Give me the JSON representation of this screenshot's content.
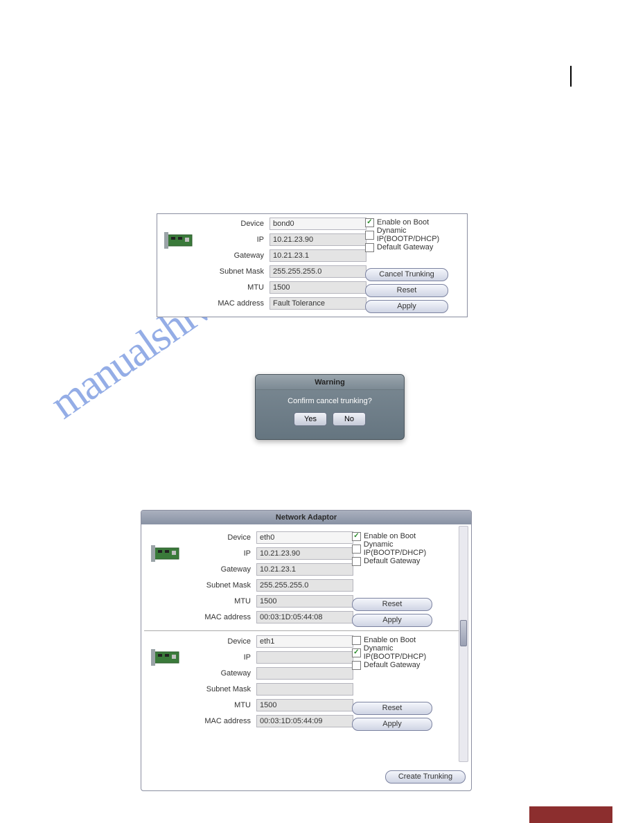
{
  "panel1": {
    "labels": {
      "device": "Device",
      "ip": "IP",
      "gateway": "Gateway",
      "subnet": "Subnet Mask",
      "mtu": "MTU",
      "mac": "MAC address"
    },
    "values": {
      "device": "bond0",
      "ip": "10.21.23.90",
      "gateway": "10.21.23.1",
      "subnet": "255.255.255.0",
      "mtu": "1500",
      "mac": "Fault Tolerance"
    },
    "options": {
      "enable_on_boot": {
        "label": "Enable on Boot",
        "checked": true
      },
      "dynamic_ip": {
        "label": "Dynamic IP(BOOTP/DHCP)",
        "checked": false
      },
      "default_gateway": {
        "label": "Default Gateway",
        "checked": false
      }
    },
    "buttons": {
      "cancel_trunking": "Cancel Trunking",
      "reset": "Reset",
      "apply": "Apply"
    }
  },
  "dialog": {
    "title": "Warning",
    "message": "Confirm cancel trunking?",
    "yes": "Yes",
    "no": "No"
  },
  "panel2": {
    "title": "Network Adaptor",
    "labels": {
      "device": "Device",
      "ip": "IP",
      "gateway": "Gateway",
      "subnet": "Subnet Mask",
      "mtu": "MTU",
      "mac": "MAC address"
    },
    "adapters": [
      {
        "device": "eth0",
        "ip": "10.21.23.90",
        "gateway": "10.21.23.1",
        "subnet": "255.255.255.0",
        "mtu": "1500",
        "mac": "00:03:1D:05:44:08",
        "enable_on_boot": true,
        "dynamic_ip": false,
        "default_gateway": false
      },
      {
        "device": "eth1",
        "ip": "",
        "gateway": "",
        "subnet": "",
        "mtu": "1500",
        "mac": "00:03:1D:05:44:09",
        "enable_on_boot": false,
        "dynamic_ip": true,
        "default_gateway": false
      }
    ],
    "options_labels": {
      "enable_on_boot": "Enable on Boot",
      "dynamic_ip": "Dynamic IP(BOOTP/DHCP)",
      "default_gateway": "Default Gateway"
    },
    "buttons": {
      "reset": "Reset",
      "apply": "Apply",
      "create_trunking": "Create Trunking"
    }
  },
  "watermark": "manualshive.com"
}
